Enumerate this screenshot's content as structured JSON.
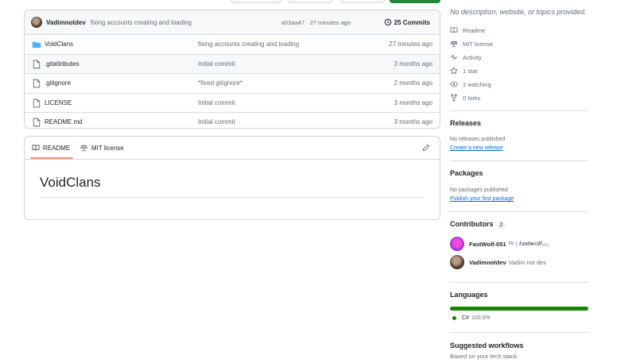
{
  "colors": {
    "link": "#0969da",
    "csharp": "#178600",
    "tab_underline": "#fd8c73"
  },
  "commit": {
    "author": "Vadimnotdev",
    "message": "fixing accounts creating and loading",
    "hash_time": "a03aa47 · 27 minutes ago",
    "count": "25 Commits"
  },
  "files": [
    {
      "name": "VoidClans",
      "type": "folder",
      "commit": "fixing accounts creating and loading",
      "age": "27 minutes ago"
    },
    {
      "name": ".gitattributes",
      "type": "file",
      "commit": "Initial commit",
      "age": "3 months ago"
    },
    {
      "name": ".gitignore",
      "type": "file",
      "commit": "*fixed gitignore*",
      "age": "2 months ago"
    },
    {
      "name": "LICENSE",
      "type": "file",
      "commit": "Initial commit",
      "age": "3 months ago"
    },
    {
      "name": "README.md",
      "type": "file",
      "commit": "Initial commit",
      "age": "3 months ago"
    }
  ],
  "readme": {
    "tab_readme": "README",
    "tab_license": "MIT license",
    "title": "VoidClans"
  },
  "sidebar": {
    "description": "No description, website, or topics provided.",
    "meta": [
      {
        "icon": "book-icon",
        "label": "Readme"
      },
      {
        "icon": "scale-icon",
        "label": "MIT license"
      },
      {
        "icon": "pulse-icon",
        "label": "Activity"
      },
      {
        "icon": "star-icon",
        "label": "1 star"
      },
      {
        "icon": "eye-icon",
        "label": "1 watching"
      },
      {
        "icon": "fork-icon",
        "label": "0 forks"
      }
    ],
    "releases": {
      "title": "Releases",
      "text": "No releases published",
      "link": "Create a new release"
    },
    "packages": {
      "title": "Packages",
      "text": "No packages published",
      "link": "Publish your first package"
    },
    "contributors": {
      "title": "Contributors",
      "count": "2",
      "people": [
        {
          "login": "FastWolf-051",
          "name": "ᴬˡᵖ | 𝒇𝒂𝒔𝒕𝒘𝒐𝒍𝒇₀₅₁"
        },
        {
          "login": "Vadimnotdev",
          "name": "Vadim not dev"
        }
      ]
    },
    "languages": {
      "title": "Languages",
      "items": [
        {
          "name": "C#",
          "percent": "100.0%",
          "share": 1.0
        }
      ]
    },
    "workflows": {
      "title": "Suggested workflows",
      "text": "Based on your tech stack"
    }
  }
}
